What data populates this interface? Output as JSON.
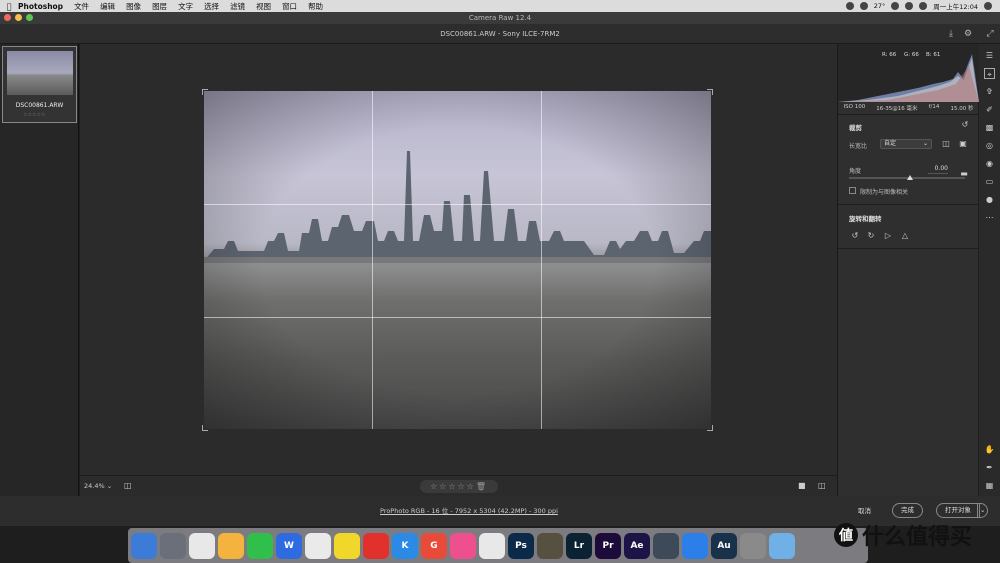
{
  "menubar": {
    "apple": "",
    "items": [
      "Photoshop",
      "文件",
      "编辑",
      "图像",
      "图层",
      "文字",
      "选择",
      "滤镜",
      "视图",
      "窗口",
      "帮助"
    ],
    "status_text": "27°",
    "clock": "周一上午12:04"
  },
  "window": {
    "title": "Camera Raw 12.4"
  },
  "toolbar": {
    "file_info": "DSC00861.ARW  -  Sony ILCE-7RM2"
  },
  "filmstrip": {
    "name": "DSC00861.ARW",
    "stars": "☆☆☆☆☆"
  },
  "bottombar": {
    "zoom": "24.4%",
    "zoom_caret": "⌄",
    "stars": "☆☆☆☆☆🗑"
  },
  "status": {
    "info": "ProPhoto RGB - 16 位 - 7952 x 5304 (42.2MP) - 300 ppi",
    "cancel": "取消",
    "done": "完成",
    "open": "打开对象"
  },
  "histogram": {
    "r": "R: 66",
    "g": "G: 66",
    "b": "B: 61"
  },
  "exif": {
    "iso": "ISO 100",
    "lens": "16-35@16 毫米",
    "aperture": "f/14",
    "shutter": "15.00 秒"
  },
  "crop": {
    "title": "裁剪",
    "aspect_label": "长宽比",
    "aspect_value": "自定",
    "angle_label": "角度",
    "angle_value": "0.00",
    "constrain_label": "限制为与图像相关",
    "rotate_title": "旋转和翻转"
  },
  "dock": {
    "icons": [
      {
        "name": "finder",
        "label": "",
        "color": "#3d7bd9"
      },
      {
        "name": "launchpad",
        "label": "",
        "color": "#6b6f7a"
      },
      {
        "name": "chrome",
        "label": "",
        "color": "#e8e8e8"
      },
      {
        "name": "notes",
        "label": "",
        "color": "#f4b23e"
      },
      {
        "name": "wechat",
        "label": "",
        "color": "#2fbf4a"
      },
      {
        "name": "wps",
        "label": "W",
        "color": "#2f6be0"
      },
      {
        "name": "clock",
        "label": "",
        "color": "#eaeaea"
      },
      {
        "name": "music",
        "label": "",
        "color": "#f1d72c"
      },
      {
        "name": "netease",
        "label": "",
        "color": "#e2312d"
      },
      {
        "name": "kugou",
        "label": "K",
        "color": "#2a8ae6"
      },
      {
        "name": "app-g",
        "label": "G",
        "color": "#e84b3a"
      },
      {
        "name": "app-pink",
        "label": "",
        "color": "#ee4f8e"
      },
      {
        "name": "qq",
        "label": "",
        "color": "#e8e8e8"
      },
      {
        "name": "photoshop",
        "label": "Ps",
        "color": "#0b2a4a"
      },
      {
        "name": "bridge",
        "label": "",
        "color": "#55503f"
      },
      {
        "name": "lightroom",
        "label": "Lr",
        "color": "#0b2233"
      },
      {
        "name": "premiere",
        "label": "Pr",
        "color": "#1c0a3a"
      },
      {
        "name": "aftereffects",
        "label": "Ae",
        "color": "#1c1347"
      },
      {
        "name": "quicktime",
        "label": "",
        "color": "#3c4a5a"
      },
      {
        "name": "feishu",
        "label": "",
        "color": "#2c7ee8"
      },
      {
        "name": "audition",
        "label": "Au",
        "color": "#17324a"
      },
      {
        "name": "settings",
        "label": "",
        "color": "#8a8a8a"
      },
      {
        "name": "folder",
        "label": "",
        "color": "#6fb0e6"
      }
    ]
  },
  "watermark": {
    "text": "什么值得买"
  }
}
